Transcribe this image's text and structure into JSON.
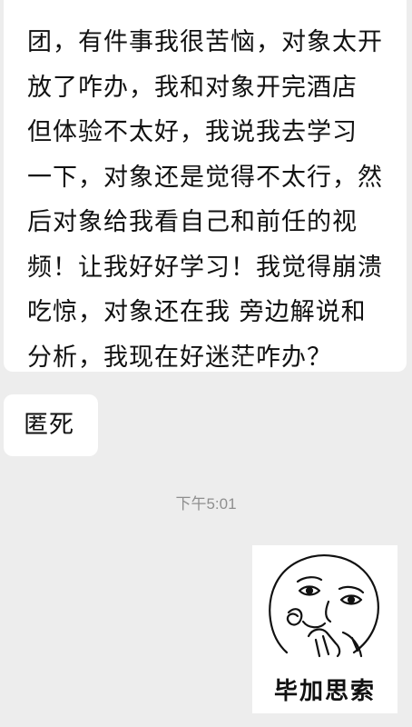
{
  "chat": {
    "message_1": {
      "lines": [
        "团，有件事我很苦恼，对象太开",
        "放了咋办，我和对象开完酒店",
        "但体验不太好，我说我去学习",
        "一下，对象还是觉得不太行，然",
        "后对象给我看自己和前任的视",
        "频！让我好好学习！我觉得崩溃",
        "吃惊，对象还在我 旁边解说和",
        "分析，我现在好迷茫咋办？"
      ]
    },
    "message_2": {
      "text": "匿死"
    },
    "timestamp": "下午5:01",
    "sticker": {
      "caption": "毕加思索",
      "icon": "meme-face-sticker"
    }
  }
}
